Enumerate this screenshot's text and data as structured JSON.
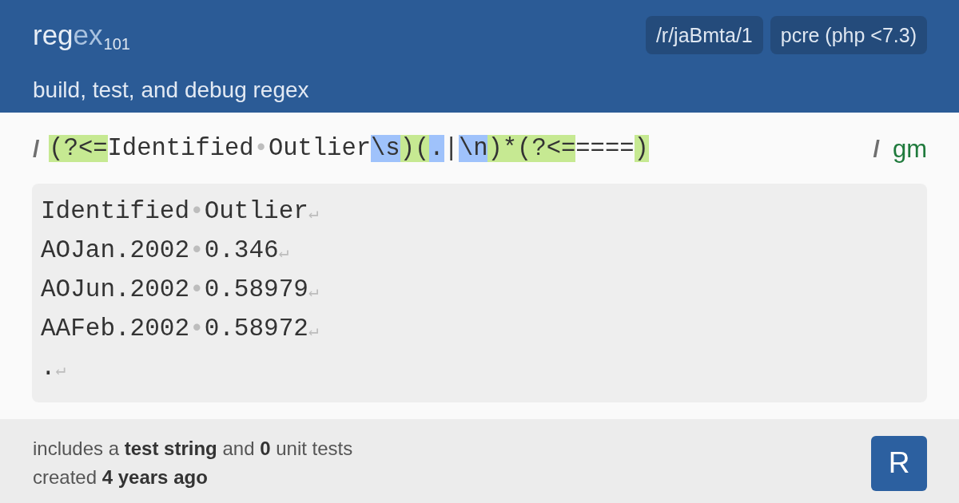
{
  "header": {
    "logo": [
      {
        "text": "reg",
        "kind": "primary"
      },
      {
        "text": "ex",
        "kind": "accent"
      },
      {
        "text": "101",
        "kind": "subscript"
      }
    ],
    "tagline": "build, test, and debug regex",
    "tags": [
      "/r/jaBmta/1",
      "pcre (php <7.3)"
    ]
  },
  "regex": {
    "open_delimiter": "/",
    "tokens": [
      {
        "text": "(?<=",
        "kind": "group"
      },
      {
        "text": "Identified",
        "kind": "literal"
      },
      {
        "text": "•",
        "kind": "whitespace"
      },
      {
        "text": "Outlier",
        "kind": "literal"
      },
      {
        "text": "\\s",
        "kind": "escape"
      },
      {
        "text": ")(",
        "kind": "group"
      },
      {
        "text": ".",
        "kind": "escape"
      },
      {
        "text": "|",
        "kind": "literal"
      },
      {
        "text": "\\n",
        "kind": "escape"
      },
      {
        "text": ")*(?<=",
        "kind": "group"
      },
      {
        "text": "====",
        "kind": "literal"
      },
      {
        "text": ")",
        "kind": "group"
      }
    ],
    "close_delimiter": "/",
    "flags": "gm"
  },
  "test_string": {
    "lines": [
      {
        "tokens": [
          {
            "text": "Identified",
            "kind": "text"
          },
          {
            "text": "•",
            "kind": "whitespace"
          },
          {
            "text": "Outlier",
            "kind": "text"
          },
          {
            "text": "↵",
            "kind": "newline"
          }
        ]
      },
      {
        "tokens": [
          {
            "text": "AOJan.2002",
            "kind": "text"
          },
          {
            "text": "•",
            "kind": "whitespace"
          },
          {
            "text": "0.346",
            "kind": "text"
          },
          {
            "text": "↵",
            "kind": "newline"
          }
        ]
      },
      {
        "tokens": [
          {
            "text": "AOJun.2002",
            "kind": "text"
          },
          {
            "text": "•",
            "kind": "whitespace"
          },
          {
            "text": "0.58979",
            "kind": "text"
          },
          {
            "text": "↵",
            "kind": "newline"
          }
        ]
      },
      {
        "tokens": [
          {
            "text": "AAFeb.2002",
            "kind": "text"
          },
          {
            "text": "•",
            "kind": "whitespace"
          },
          {
            "text": "0.58972",
            "kind": "text"
          },
          {
            "text": "↵",
            "kind": "newline"
          }
        ]
      },
      {
        "tokens": [
          {
            "text": ".",
            "kind": "text"
          },
          {
            "text": "↵",
            "kind": "newline"
          }
        ]
      }
    ]
  },
  "footer": {
    "lines": [
      "includes a **test string** and **0** unit tests",
      "created **4 years ago**"
    ],
    "logo_letter": "R"
  }
}
